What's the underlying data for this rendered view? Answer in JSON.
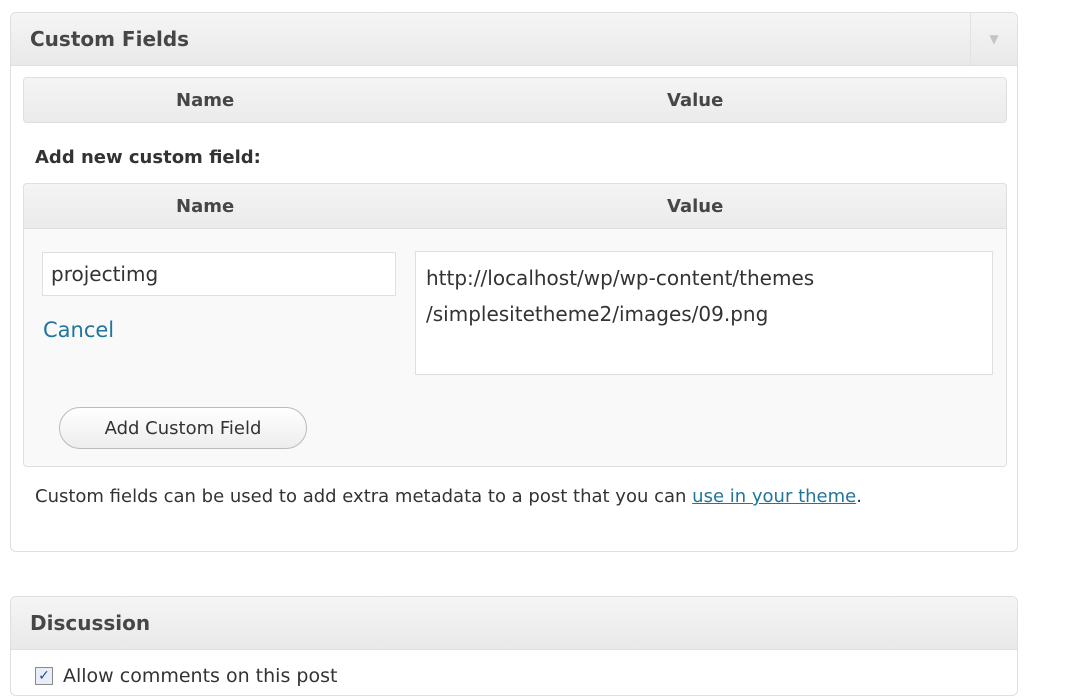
{
  "custom_fields": {
    "title": "Custom Fields",
    "toggle_icon": "▼",
    "list_header": {
      "name": "Name",
      "value": "Value"
    },
    "add_label": "Add new custom field:",
    "add_header": {
      "name": "Name",
      "value": "Value"
    },
    "name_value": "projectimg",
    "value_value": "http://localhost/wp/wp-content/themes\n/simplesitetheme2/images/09.png",
    "cancel_label": "Cancel",
    "add_button_label": "Add Custom Field",
    "help_text": "Custom fields can be used to add extra metadata to a post that you can ",
    "help_link": "use in your theme",
    "help_end": "."
  },
  "discussion": {
    "title": "Discussion",
    "allow_comments_label": "Allow comments on this post",
    "checkbox_mark": "✓"
  }
}
